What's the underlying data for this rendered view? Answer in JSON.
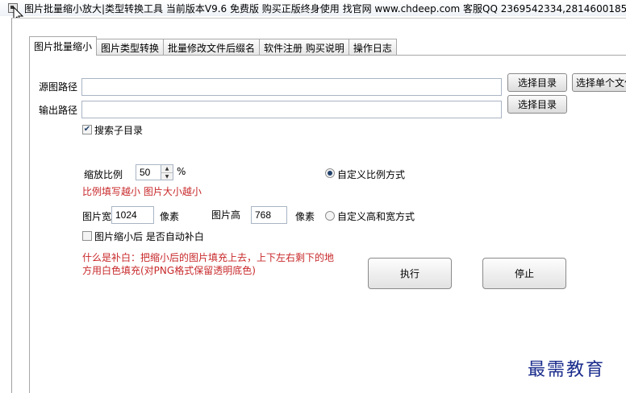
{
  "window": {
    "title": "图片批量缩小放大|类型转换工具 当前版本V9.6 免费版 购买正版终身使用 找官网 www.chdeep.com  客服QQ 2369542334,2814600185"
  },
  "tabs": [
    {
      "label": "图片批量缩小",
      "active": true
    },
    {
      "label": "图片类型转换"
    },
    {
      "label": "批量修改文件后缀名"
    },
    {
      "label": "软件注册 购买说明"
    },
    {
      "label": "操作日志"
    }
  ],
  "source": {
    "label": "源图路径",
    "value": "",
    "browse_dir": "选择目录",
    "browse_file": "选择单个文件"
  },
  "output": {
    "label": "输出路径",
    "value": "",
    "browse_dir": "选择目录"
  },
  "include_subdirs": {
    "label": "搜索子目录",
    "checked": true
  },
  "scale": {
    "label": "缩放比例",
    "value": "50",
    "unit": "%",
    "hint": "比例填写越小 图片大小越小"
  },
  "mode_ratio": {
    "label": "自定义比例方式",
    "selected": true
  },
  "size": {
    "width_label": "图片宽",
    "width": "1024",
    "unit1": "像素",
    "height_label": "图片高",
    "height": "768",
    "unit2": "像素"
  },
  "mode_custom": {
    "label": "自定义高和宽方式",
    "selected": false
  },
  "pad": {
    "label": "图片缩小后 是否自动补白",
    "checked": false,
    "hint_line1": "什么是补白：把缩小后的图片填充上去，上下左右剩下的地",
    "hint_line2": "方用白色填充(对PNG格式保留透明底色)"
  },
  "actions": {
    "run": "执行",
    "stop": "停止"
  },
  "watermark": "最需教育"
}
